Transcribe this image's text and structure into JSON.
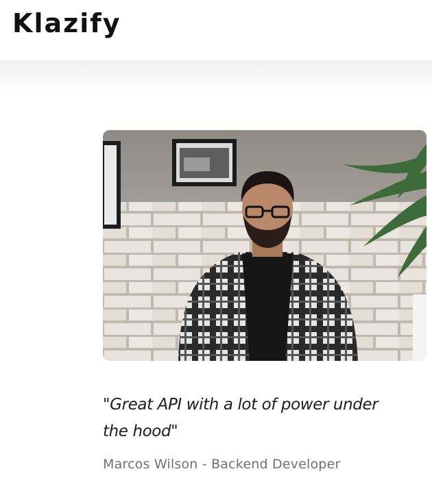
{
  "header": {
    "logo": "Klazify"
  },
  "testimonial": {
    "photo_icon": "person-photo",
    "quote": "\"Great API with a lot of power under the hood\"",
    "author": "Marcos Wilson - Backend Developer"
  }
}
